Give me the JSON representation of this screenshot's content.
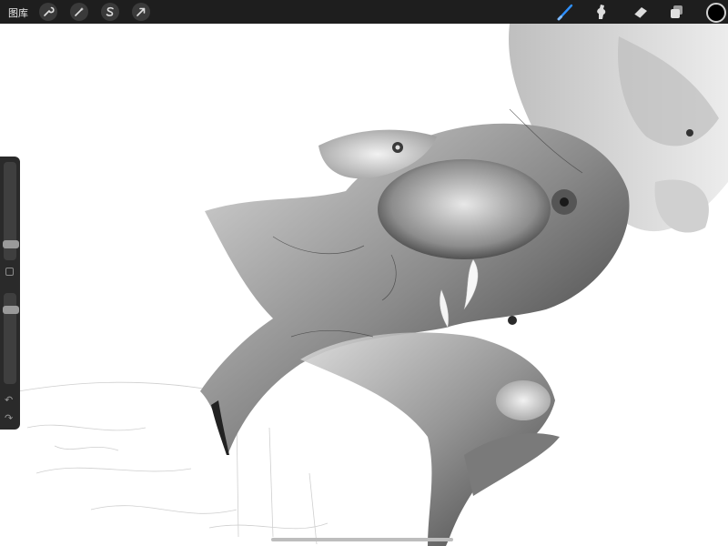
{
  "toolbar": {
    "gallery_label": "图库",
    "left_tools": [
      {
        "name": "actions-wrench-icon"
      },
      {
        "name": "adjustments-magic-wand-icon"
      },
      {
        "name": "selection-s-icon"
      },
      {
        "name": "transform-arrow-icon"
      }
    ],
    "right_tools": [
      {
        "name": "brush-icon",
        "active": true
      },
      {
        "name": "smudge-icon"
      },
      {
        "name": "eraser-icon"
      },
      {
        "name": "layers-icon"
      }
    ],
    "current_color": "#000000",
    "accent_color": "#2e8fff"
  },
  "sidebar": {
    "brush_size_level": 0.32,
    "opacity_level": 0.86,
    "undo_icon": "undo-arrow-icon",
    "redo_icon": "redo-arrow-icon"
  },
  "canvas": {
    "background": "#ffffff",
    "artwork_description_icon": "graphite-creature-artwork"
  }
}
